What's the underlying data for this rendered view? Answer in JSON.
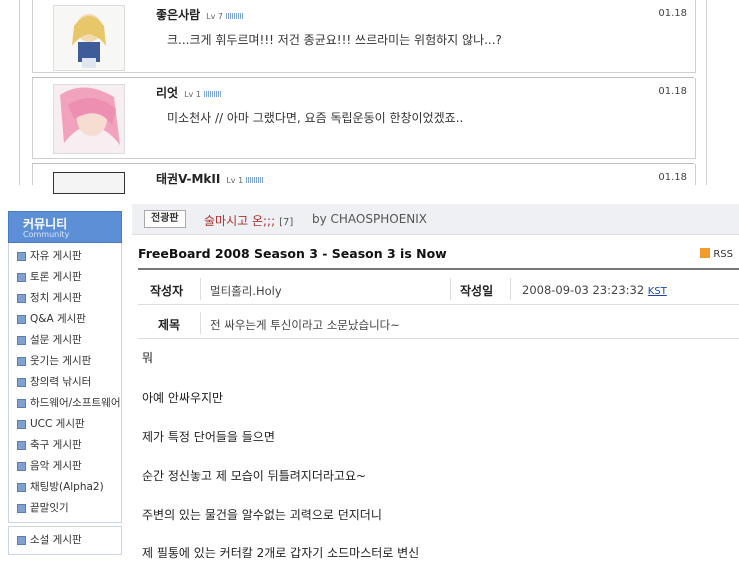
{
  "comments": [
    {
      "name": "좋은사람",
      "level": "Lv 7",
      "date": "01.18",
      "text": "크...크게 휘두르며!!! 저건 종균요!!! 쓰르라미는 위험하지 않나...?"
    },
    {
      "name": "리엇",
      "level": "Lv 1",
      "date": "01.18",
      "text": "미소천사 // 아마 그랬다면, 요즘 독립운동이 한창이었겠죠.."
    },
    {
      "name": "태권V-MkII",
      "level": "Lv 1",
      "date": "01.18",
      "text": ""
    }
  ],
  "sidebar": {
    "title": "커뮤니티",
    "subtitle": "Community",
    "items": [
      "자유 게시판",
      "토론 게시판",
      "정치 게시판",
      "Q&A 게시판",
      "설문 게시판",
      "웃기는 게시판",
      "창의력 낚시터",
      "하드웨어/소프트웨어",
      "UCC 게시판",
      "축구 게시판",
      "음악 게시판",
      "채팅방(Alpha2)",
      "끝말잇기"
    ],
    "items2": [
      "소설 게시판"
    ]
  },
  "post": {
    "badge": "전광판",
    "title": "술마시고 온;;;",
    "count": "[7]",
    "by": "by CHAOSPHOENIX",
    "board": "FreeBoard 2008 Season 3 - Season 3 is Now",
    "rss": "RSS",
    "author_label": "작성자",
    "author": "멀티홀리.Holy",
    "date_label": "작성일",
    "date": "2008-09-03 23:23:32",
    "tz": "KST",
    "subject_label": "제목",
    "subject": "전 싸우는게 투신이라고 소문났습니다~",
    "lines": [
      "뭐",
      "아예 안싸우지만",
      "제가 특정 단어들을 들으면",
      "순간 정신놓고 제 모습이 뒤틀려지더라고요~",
      "주변의 있는 물건을 알수없는 괴력으로 던지더니",
      "제 필통에 있는 커터칼 2개로 갑자기 소드마스터로 변신"
    ]
  }
}
